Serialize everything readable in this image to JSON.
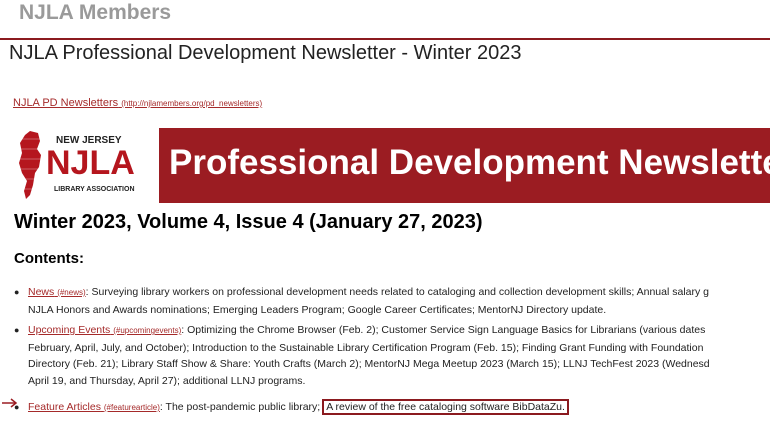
{
  "site": {
    "title": "NJLA Members"
  },
  "page": {
    "title": "NJLA Professional Development Newsletter - Winter 2023"
  },
  "breadcrumb": {
    "label": "NJLA PD Newsletters",
    "url": "(http://njlamembers.org/pd_newsletters)"
  },
  "logo": {
    "line1": "NEW JERSEY",
    "line2": "NJLA",
    "line3": "LIBRARY ASSOCIATION"
  },
  "banner": {
    "text": "Professional Development Newsletter"
  },
  "issue": {
    "title": "Winter 2023, Volume 4, Issue 4 (January 27, 2023)"
  },
  "contents": {
    "heading": "Contents:",
    "items": [
      {
        "link": "News",
        "anchor": "(#news)",
        "lines": [
          ": Surveying library workers on professional development needs related to cataloging and collection development skills; Annual salary g",
          "NJLA Honors and Awards nominations; Emerging Leaders Program; Google Career Certificates; MentorNJ Directory update."
        ]
      },
      {
        "link": "Upcoming Events",
        "anchor": "(#upcomingevents)",
        "lines": [
          ": Optimizing the Chrome Browser (Feb. 2); Customer Service Sign Language Basics for Librarians (various dates",
          "February, April, July, and October); Introduction to the Sustainable Library Certification Program (Feb. 15); Finding Grant Funding with Foundation",
          "Directory (Feb. 21); Library Staff Show & Share: Youth Crafts (March 2); MentorNJ Mega Meetup 2023 (March 15); LLNJ TechFest 2023 (Wednesd",
          "April 19, and Thursday, April 27); additional LLNJ programs."
        ]
      },
      {
        "link": "Feature Articles",
        "anchor": "(#featurearticle)",
        "text": ": The post-pandemic public library;",
        "highlight": "A review of the free cataloging software BibDataZu."
      }
    ]
  },
  "colors": {
    "accent": "#9b1c22",
    "link": "#a52a2a",
    "site_title": "#9a9a9a"
  }
}
